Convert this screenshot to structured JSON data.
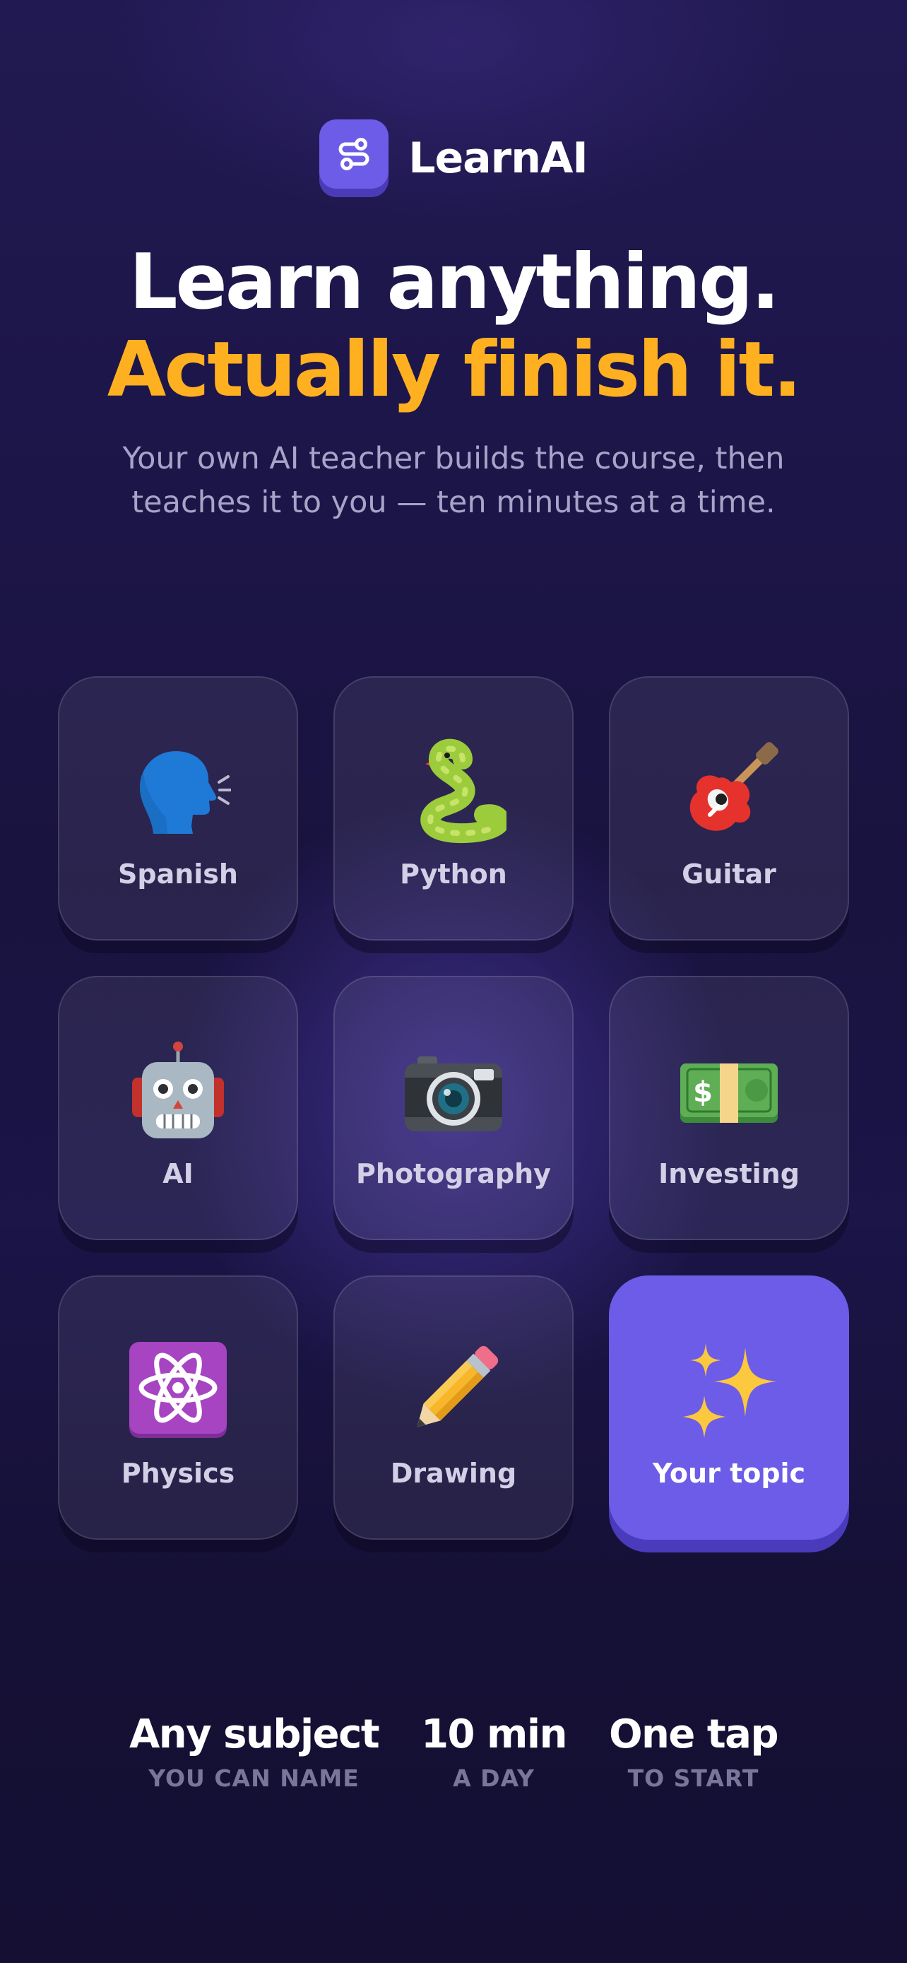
{
  "brand": {
    "name": "LearnAI",
    "icon": "route-icon",
    "accent": "#6c5ce7"
  },
  "hero": {
    "line1": "Learn anything.",
    "line2": "Actually finish it.",
    "line2_color": "#ffb020",
    "subtitle": "Your own AI teacher builds the course, then teaches it to you — ten minutes at a time."
  },
  "topics": [
    {
      "label": "Spanish",
      "icon": "speaking-head-icon"
    },
    {
      "label": "Python",
      "icon": "snake-icon"
    },
    {
      "label": "Guitar",
      "icon": "guitar-icon"
    },
    {
      "label": "AI",
      "icon": "robot-icon"
    },
    {
      "label": "Photography",
      "icon": "camera-icon"
    },
    {
      "label": "Investing",
      "icon": "dollar-banknote-icon"
    },
    {
      "label": "Physics",
      "icon": "atom-symbol-icon"
    },
    {
      "label": "Drawing",
      "icon": "pencil-icon"
    },
    {
      "label": "Your topic",
      "icon": "sparkles-icon",
      "featured": true
    }
  ],
  "stats": [
    {
      "value": "Any subject",
      "caption": "YOU CAN NAME"
    },
    {
      "value": "10 min",
      "caption": "A DAY"
    },
    {
      "value": "One tap",
      "caption": "TO START"
    }
  ]
}
